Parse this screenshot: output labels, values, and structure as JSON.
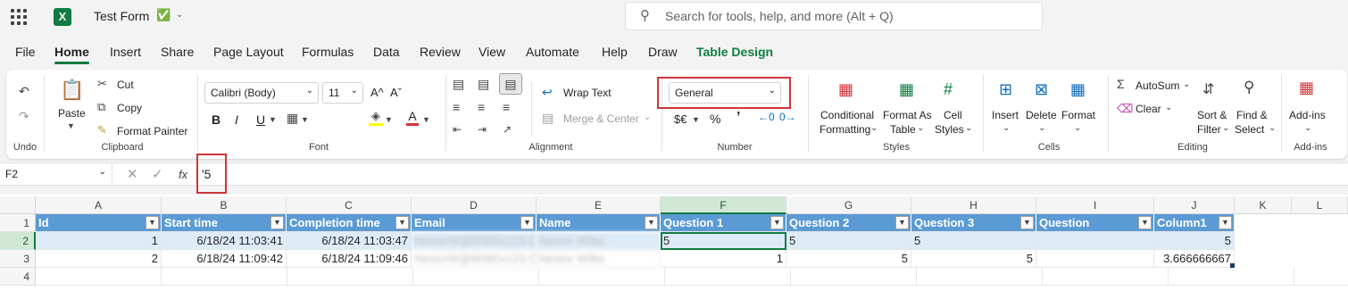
{
  "app": {
    "title": "Test Form",
    "logo": "X"
  },
  "search": {
    "placeholder": "Search for tools, help, and more (Alt + Q)"
  },
  "tabs": [
    "File",
    "Home",
    "Insert",
    "Share",
    "Page Layout",
    "Formulas",
    "Data",
    "Review",
    "View",
    "Automate",
    "Help",
    "Draw",
    "Table Design"
  ],
  "ribbon": {
    "undo_label": "Undo",
    "clipboard": {
      "label": "Clipboard",
      "paste": "Paste",
      "cut": "Cut",
      "copy": "Copy",
      "format_painter": "Format Painter"
    },
    "font": {
      "label": "Font",
      "family": "Calibri (Body)",
      "size": "11",
      "grow": "A^",
      "shrink": "Aˇ",
      "bold": "B",
      "italic": "I",
      "underline": "U",
      "color_a": "A"
    },
    "alignment": {
      "label": "Alignment",
      "wrap": "Wrap Text",
      "merge": "Merge & Center"
    },
    "number": {
      "label": "Number",
      "format": "General",
      "currency": "$€",
      "percent": "%",
      "comma": "’"
    },
    "styles": {
      "label": "Styles",
      "conditional1": "Conditional",
      "conditional2": "Formatting",
      "format_as1": "Format As",
      "format_as2": "Table",
      "cell1": "Cell",
      "cell2": "Styles"
    },
    "cells": {
      "label": "Cells",
      "insert": "Insert",
      "delete": "Delete",
      "format": "Format"
    },
    "editing": {
      "label": "Editing",
      "autosum": "AutoSum",
      "clear": "Clear",
      "sort1": "Sort &",
      "sort2": "Filter",
      "find1": "Find &",
      "find2": "Select"
    },
    "addins": {
      "label": "Add-ins",
      "btn": "Add-ins"
    }
  },
  "formula_bar": {
    "name_box": "F2",
    "fx": "fx",
    "value": "'5"
  },
  "columns": [
    "A",
    "B",
    "C",
    "D",
    "E",
    "F",
    "G",
    "H",
    "I",
    "J",
    "K",
    "L"
  ],
  "rows": [
    "1",
    "2",
    "3",
    "4"
  ],
  "table": {
    "headers": [
      "Id",
      "Start time",
      "Completion time",
      "Email",
      "Name",
      "Question 1",
      "Question 2",
      "Question 3",
      "Question",
      "Column1"
    ],
    "row2": [
      "1",
      "6/18/24 11:03:41",
      "6/18/24 11:03:47",
      "NestorW@M365x123.OnMicrosoft.com",
      "Nestor Wilke",
      "5",
      "5",
      "5",
      "",
      "5"
    ],
    "row3": [
      "2",
      "6/18/24 11:09:42",
      "6/18/24 11:09:46",
      "NestorW@M365x123.OnMicrosoft.com",
      "Nestor Wilke",
      "1",
      "5",
      "5",
      "",
      "3.666666667"
    ]
  },
  "colors": {
    "accent": "#107c41",
    "table_header": "#5b9bd5",
    "table_band": "#ddebf7",
    "highlight": "#d13438"
  }
}
